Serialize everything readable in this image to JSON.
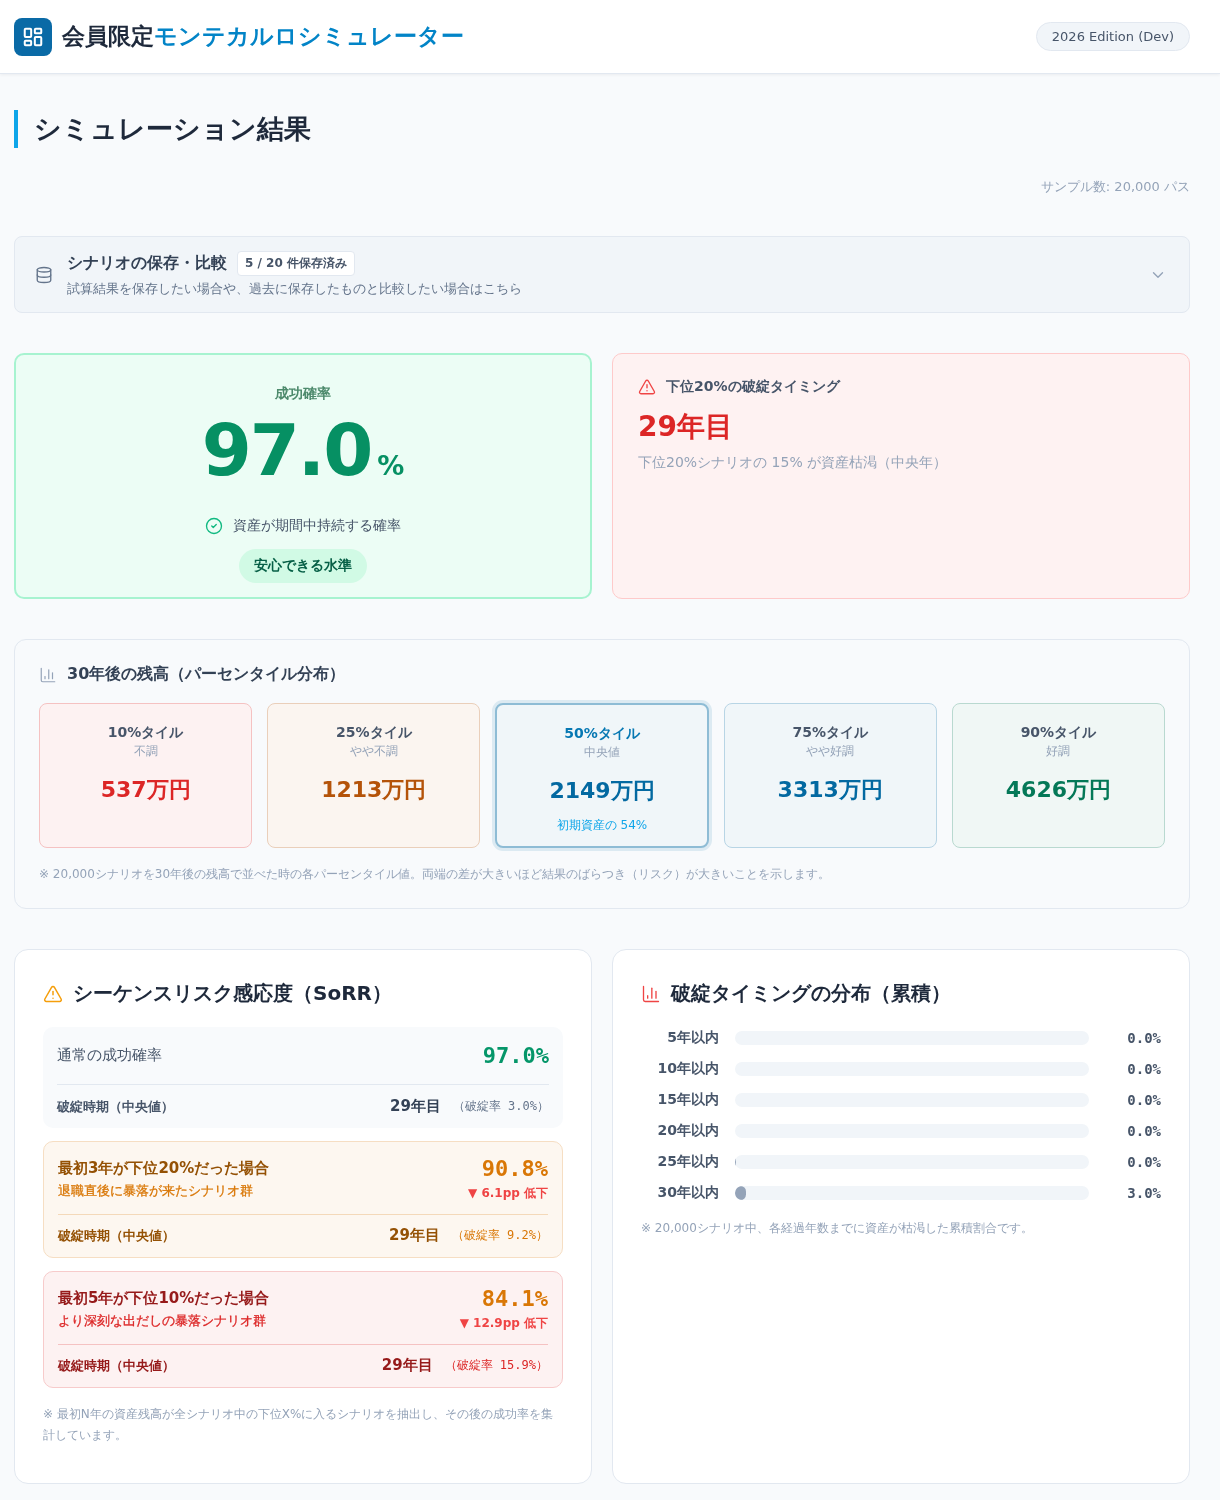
{
  "header": {
    "title_prefix": "会員限定",
    "title_accent": "モンテカルロシミュレーター",
    "edition_badge": "2026 Edition (Dev)"
  },
  "page": {
    "heading": "シミュレーション結果",
    "sample_count": "サンプル数: 20,000 パス"
  },
  "scenario_panel": {
    "title": "シナリオの保存・比較",
    "badge": "5 / 20 件保存済み",
    "description": "試算結果を保存したい場合や、過去に保存したものと比較したい場合はこちら",
    "expanded": false
  },
  "success_card": {
    "label": "成功確率",
    "value": "97.0",
    "unit": "%",
    "caption": "資産が期間中持続する確率",
    "verdict": "安心できる水準"
  },
  "ruin_card": {
    "title": "下位20%の破綻タイミング",
    "value": "29年目",
    "caption": "下位20%シナリオの 15% が資産枯渇（中央年）"
  },
  "percentiles": {
    "title": "30年後の残高（パーセンタイル分布）",
    "tiles": [
      {
        "label": "10%タイル",
        "sublabel": "不調",
        "value": "537万円",
        "color": "#dc2626",
        "highlighted": false
      },
      {
        "label": "25%タイル",
        "sublabel": "やや不調",
        "value": "1213万円",
        "color": "#b45309",
        "highlighted": false
      },
      {
        "label": "50%タイル",
        "sublabel": "中央値",
        "value": "2149万円",
        "note": "初期資産の 54%",
        "color": "#0369a1",
        "highlighted": true
      },
      {
        "label": "75%タイル",
        "sublabel": "やや好調",
        "value": "3313万円",
        "color": "#0369a1",
        "highlighted": false
      },
      {
        "label": "90%タイル",
        "sublabel": "好調",
        "value": "4626万円",
        "color": "#047857",
        "highlighted": false
      }
    ],
    "footnote": "※ 20,000シナリオを30年後の残高で並べた時の各パーセンタイル値。両端の差が大きいほど結果のばらつき（リスク）が大きいことを示します。"
  },
  "sorr": {
    "title": "シーケンスリスク感応度（SoRR）",
    "baseline": {
      "label": "通常の成功確率",
      "value": "97.0%",
      "timing_label": "破綻時期（中央値）",
      "timing_value": "29年目",
      "ruin_rate": "（破綻率 3.0%）"
    },
    "scenarios": [
      {
        "title": "最初3年が下位20%だった場合",
        "subtitle": "退職直後に暴落が来たシナリオ群",
        "value": "90.8%",
        "delta": "▼ 6.1pp 低下",
        "timing_label": "破綻時期（中央値）",
        "timing_value": "29年目",
        "ruin_rate": "（破綻率 9.2%）",
        "color": "#d97706"
      },
      {
        "title": "最初5年が下位10%だった場合",
        "subtitle": "より深刻な出だしの暴落シナリオ群",
        "value": "84.1%",
        "delta": "▼ 12.9pp 低下",
        "timing_label": "破綻時期（中央値）",
        "timing_value": "29年目",
        "ruin_rate": "（破綻率 15.9%）",
        "color": "#dc2626"
      }
    ],
    "footnote": "※ 最初N年の資産残高が全シナリオ中の下位X%に入るシナリオを抽出し、その後の成功率を集計しています。"
  },
  "ruin_timing": {
    "title": "破綻タイミングの分布（累積）",
    "rows": [
      {
        "label": "5年以内",
        "reading": "0.0%"
      },
      {
        "label": "10年以内",
        "reading": "0.0%"
      },
      {
        "label": "15年以内",
        "reading": "0.0%"
      },
      {
        "label": "20年以内",
        "reading": "0.0%"
      },
      {
        "label": "25年以内",
        "level": 0.002,
        "reading": "0.0%"
      },
      {
        "label": "30年以内",
        "level": 0.03,
        "reading": "3.0%"
      }
    ],
    "footnote": "※ 20,000シナリオ中、各経過年数までに資産が枯渇した累積割合です。"
  }
}
